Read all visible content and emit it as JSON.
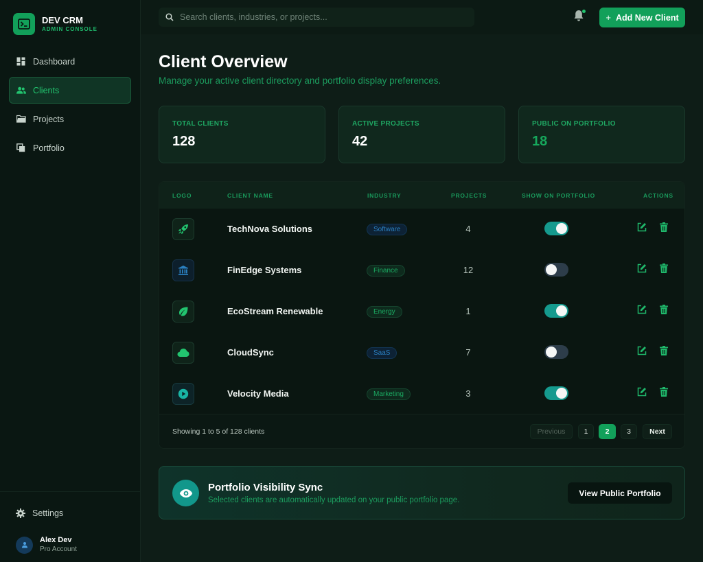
{
  "brand": {
    "name": "DEV CRM",
    "subtitle": "ADMIN CONSOLE"
  },
  "sidebar": {
    "items": [
      {
        "label": "Dashboard",
        "icon": "dashboard-icon"
      },
      {
        "label": "Clients",
        "icon": "users-icon",
        "active": true
      },
      {
        "label": "Projects",
        "icon": "folder-icon"
      },
      {
        "label": "Portfolio",
        "icon": "copy-icon"
      }
    ],
    "settings_label": "Settings",
    "user": {
      "name": "Alex Dev",
      "role": "Pro Account"
    }
  },
  "header": {
    "search_placeholder": "Search clients, industries, or projects...",
    "add_button": "Add New Client"
  },
  "page": {
    "title": "Client Overview",
    "subtitle": "Manage your active client directory and portfolio display preferences."
  },
  "stats": [
    {
      "label": "TOTAL CLIENTS",
      "value": "128"
    },
    {
      "label": "ACTIVE PROJECTS",
      "value": "42"
    },
    {
      "label": "PUBLIC ON PORTFOLIO",
      "value": "18"
    }
  ],
  "table": {
    "headers": {
      "logo": "LOGO",
      "name": "CLIENT NAME",
      "industry": "INDUSTRY",
      "projects": "PROJECTS",
      "portfolio": "SHOW ON PORTFOLIO",
      "actions": "ACTIONS"
    },
    "rows": [
      {
        "name": "TechNova Solutions",
        "industry": "Software",
        "projects": "4",
        "show_on_portfolio": true,
        "logo_icon": "rocket-icon"
      },
      {
        "name": "FinEdge Systems",
        "industry": "Finance",
        "projects": "12",
        "show_on_portfolio": false,
        "logo_icon": "bank-icon"
      },
      {
        "name": "EcoStream Renewable",
        "industry": "Energy",
        "projects": "1",
        "show_on_portfolio": true,
        "logo_icon": "leaf-icon"
      },
      {
        "name": "CloudSync",
        "industry": "SaaS",
        "projects": "7",
        "show_on_portfolio": false,
        "logo_icon": "cloud-icon"
      },
      {
        "name": "Velocity Media",
        "industry": "Marketing",
        "projects": "3",
        "show_on_portfolio": true,
        "logo_icon": "play-icon"
      }
    ],
    "footer": {
      "showing": "Showing 1 to 5 of 128 clients",
      "previous": "Previous",
      "pages": [
        "1",
        "2",
        "3"
      ],
      "current_page": "2",
      "next": "Next"
    }
  },
  "sync": {
    "title": "Portfolio Visibility Sync",
    "subtitle": "Selected clients are automatically updated on your public portfolio page.",
    "button": "View Public Portfolio"
  },
  "colors": {
    "accent": "#12a05a",
    "toggle_on": "#159a8e",
    "toggle_off": "#2d3d4a",
    "background": "#0e1d17"
  }
}
